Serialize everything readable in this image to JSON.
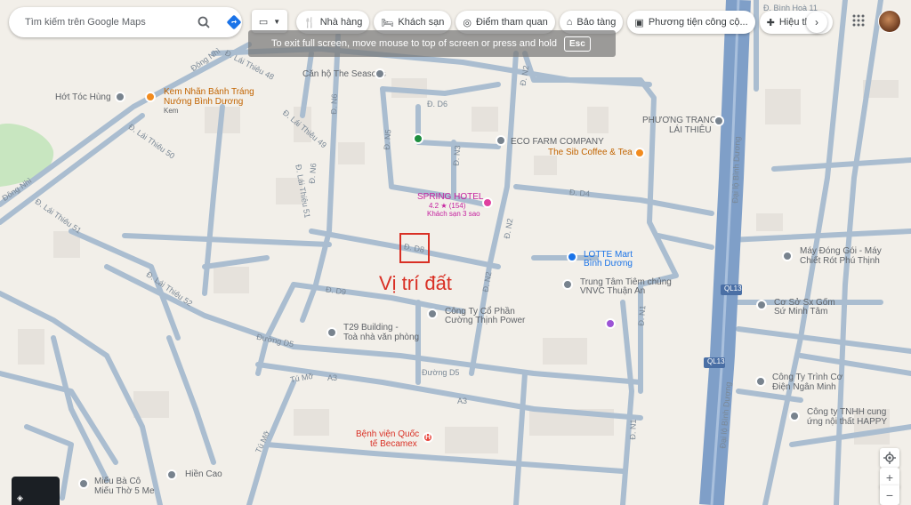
{
  "search": {
    "placeholder": "Tìm kiếm trên Google Maps"
  },
  "chips": [
    {
      "icon": "restaurant-icon",
      "label": "Nhà hàng"
    },
    {
      "icon": "hotel-icon",
      "label": "Khách sạn"
    },
    {
      "icon": "camera-icon",
      "label": "Điểm tham quan"
    },
    {
      "icon": "museum-icon",
      "label": "Bảo tàng"
    },
    {
      "icon": "transit-icon",
      "label": "Phương tiện công cộ..."
    },
    {
      "icon": "pharmacy-icon",
      "label": "Hiệu thuốc"
    }
  ],
  "fullscreen_banner": {
    "text": "To exit full screen, move mouse to top of screen or press and hold",
    "key": "Esc"
  },
  "annotation": {
    "label": "Vị trí đất",
    "color": "#d93025"
  },
  "places": [
    {
      "name": "Hớt Tóc Hùng",
      "type": "gray"
    },
    {
      "name": "Kem Nhãn Bánh Tráng",
      "type": "orange"
    },
    {
      "name": "Nướng Bình Dương",
      "type": "orange"
    },
    {
      "name": "Kem",
      "type": "orange-sub"
    },
    {
      "name": "Căn hộ The Seasons",
      "type": "gray"
    },
    {
      "name": "ECO FARM COMPANY",
      "type": "gray"
    },
    {
      "name": "The Sib Coffee & Tea",
      "type": "orange"
    },
    {
      "name": "PHƯƠNG TRANG",
      "type": "gray"
    },
    {
      "name": "LÁI THIÊU",
      "type": "gray"
    },
    {
      "name": "SPRING HOTEL",
      "type": "pink"
    },
    {
      "name": "4.2 ★ (154)",
      "type": "pink"
    },
    {
      "name": "Khách sạn 3 sao",
      "type": "pink"
    },
    {
      "name": "LOTTE Mart",
      "type": "blue"
    },
    {
      "name": "Bình Dương",
      "type": "blue"
    },
    {
      "name": "Trung Tâm Tiêm chủng",
      "type": "gray"
    },
    {
      "name": "VNVC Thuận An",
      "type": "gray"
    },
    {
      "name": "Máy Đóng Gói - Máy",
      "type": "gray"
    },
    {
      "name": "Chiết Rót Phú Thịnh",
      "type": "gray"
    },
    {
      "name": "Cơ Sở Sx Gốm",
      "type": "gray"
    },
    {
      "name": "Sứ Minh Tâm",
      "type": "gray"
    },
    {
      "name": "Công Ty Cổ Phần",
      "type": "gray"
    },
    {
      "name": "Cường Thịnh Power",
      "type": "gray"
    },
    {
      "name": "T29 Building -",
      "type": "gray"
    },
    {
      "name": "Toà nhà văn phòng",
      "type": "gray"
    },
    {
      "name": "Công Ty Trình Cơ",
      "type": "gray"
    },
    {
      "name": "Điện Ngân Minh",
      "type": "gray"
    },
    {
      "name": "Công ty TNHH cung",
      "type": "gray"
    },
    {
      "name": "ứng nội thất HAPPY",
      "type": "gray"
    },
    {
      "name": "Bệnh viện Quốc",
      "type": "red"
    },
    {
      "name": "tế Becamex",
      "type": "red"
    },
    {
      "name": "Hiền Cao",
      "type": "gray"
    },
    {
      "name": "Miếu Bà Cô",
      "type": "gray"
    },
    {
      "name": "Miếu Thờ 5 Me",
      "type": "gray"
    }
  ],
  "roads": {
    "dong_nhi_top": "Đông Nhì",
    "dong_nhi_left": "Đông Nhì",
    "binh_hoa_11": "Đ. Bình Hoà 11",
    "lai_thieu_48": "Đ. Lái Thiêu 48",
    "lai_thieu_49": "Đ. Lái Thiêu 49",
    "lai_thieu_50": "Đ. Lái Thiêu 50",
    "lai_thieu_51": "Đ. Lái Thiêu 51",
    "lai_thieu_51b": "Đ. Lái Thiêu 51",
    "lai_thieu_52": "Đ. Lái Thiêu 52",
    "d6": "Đ. D6",
    "d4": "Đ. D4",
    "d8": "Đ. D8",
    "d9": "Đ. D9",
    "n1": "Đ. N1",
    "n2_top": "Đ. N2",
    "n2_mid": "Đ. N2",
    "n2_low": "Đ. N2",
    "n3": "Đ. N3",
    "n5": "Đ. N5",
    "n6": "Đ. N6",
    "n6b": "Đ. N6",
    "duong_d5_left": "Đường D5",
    "duong_d5_mid": "Đường D5",
    "tu_mo": "Tú Mỡ",
    "tu_mo_b": "Tú Mỡ",
    "a3_left": "A3",
    "a3_right": "A3",
    "binh_duong_upper": "Đại lộ Bình Dương",
    "binh_duong_lower": "Đại lộ Bình Dương",
    "ql13_upper": "QL13",
    "ql13_lower": "QL13",
    "n1_right": "Đ. N1"
  },
  "controls": {
    "zoom_in": "+",
    "zoom_out": "−"
  },
  "colors": {
    "background": "#f2efe9",
    "minor_road": "#aabdd0",
    "highway": "#7f9fc8",
    "park": "#c8e6c0"
  }
}
